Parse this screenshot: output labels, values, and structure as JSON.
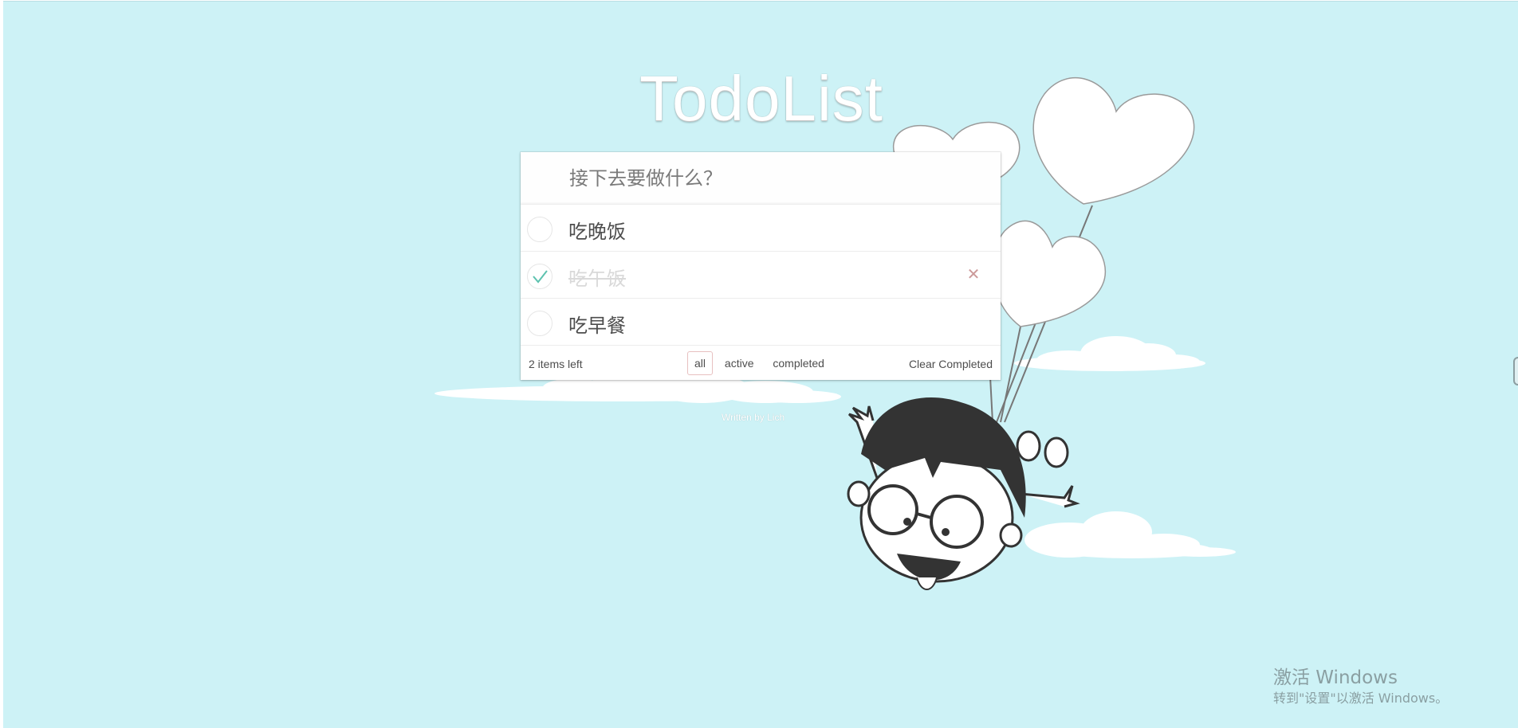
{
  "app": {
    "title": "TodoList"
  },
  "new_todo": {
    "placeholder": "接下去要做什么？"
  },
  "todos": [
    {
      "label": "吃晚饭",
      "completed": false
    },
    {
      "label": "吃午饭",
      "completed": true
    },
    {
      "label": "吃早餐",
      "completed": false
    }
  ],
  "icons": {
    "check": "check-icon",
    "destroy": "close-icon"
  },
  "destroy_glyph": "✕",
  "footer": {
    "count": "2 items left",
    "filters": [
      "all",
      "active",
      "completed"
    ],
    "selected_filter": "all",
    "clear": "Clear Completed"
  },
  "credit": "Written by Lich",
  "watermark": {
    "title": "激活 Windows",
    "subtitle": "转到\"设置\"以激活 Windows。"
  },
  "colors": {
    "background": "#cdf2f6",
    "check": "#5dc2af",
    "destroy": "#cc9a9a",
    "filter_border": "#e7b6b6"
  }
}
